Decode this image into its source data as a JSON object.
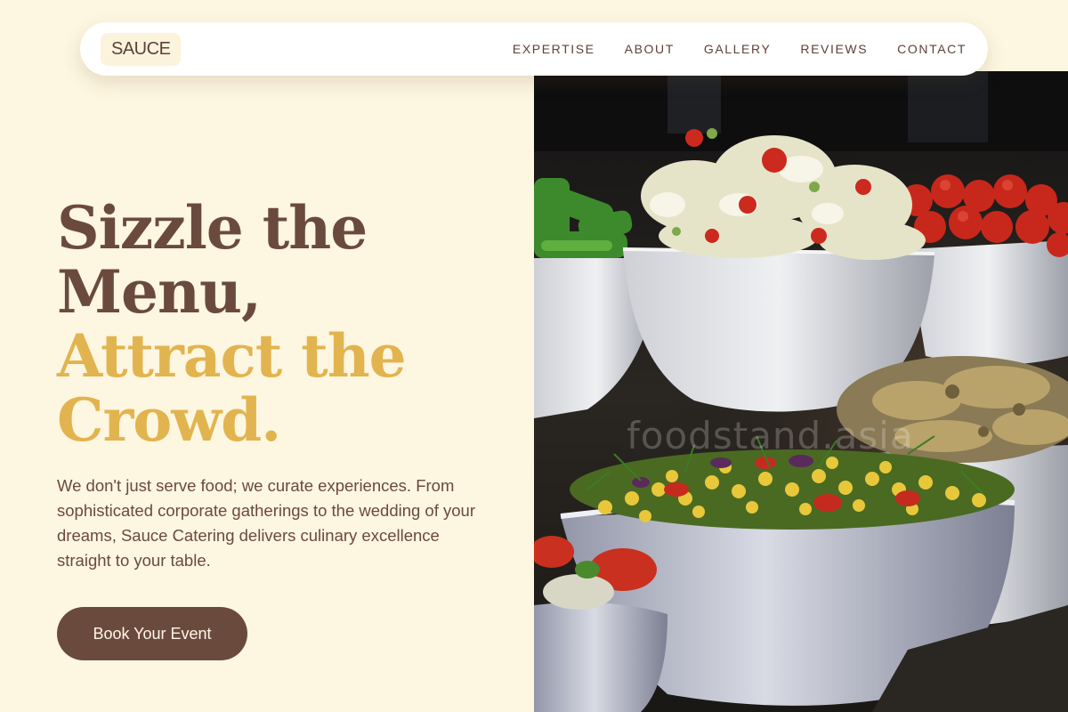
{
  "brand": {
    "logo": "SAUCE"
  },
  "nav": {
    "items": [
      {
        "label": "EXPERTISE"
      },
      {
        "label": "ABOUT"
      },
      {
        "label": "GALLERY"
      },
      {
        "label": "REVIEWS"
      },
      {
        "label": "CONTACT"
      }
    ]
  },
  "hero": {
    "headline_dark": [
      "Sizzle the",
      "Menu,"
    ],
    "headline_gold": [
      "Attract the",
      "Crowd."
    ],
    "description": "We don't just serve food; we curate experiences. From sophisticated corporate gatherings to the wedding of your dreams, Sauce Catering delivers culinary excellence straight to your table.",
    "cta_label": "Book Your Event",
    "image_watermark": "foodstand.asia"
  },
  "colors": {
    "background": "#fdf6e0",
    "brown": "#6b4a3e",
    "gold": "#e2b44f",
    "nav_bg": "#ffffff"
  }
}
